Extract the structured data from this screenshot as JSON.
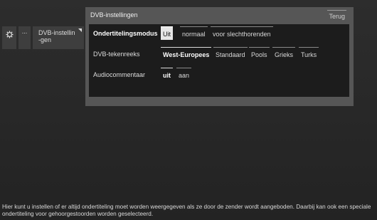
{
  "breadcrumb": {
    "gear_icon": "gear-icon",
    "more_label": "...",
    "current_label": "DVB-instellin-gen"
  },
  "dialog": {
    "title": "DVB-instellingen",
    "back_label": "Terug",
    "rows": [
      {
        "label": "Ondertitelingsmodus",
        "options": [
          "Uit",
          "normaal",
          "voor slechthorenden"
        ],
        "selected": "Uit"
      },
      {
        "label": "DVB-tekenreeks",
        "options": [
          "West-Europees",
          "Standaard",
          "Pools",
          "Grieks",
          "Turks"
        ],
        "selected": "West-Europees"
      },
      {
        "label": "Audiocommentaar",
        "options": [
          "uit",
          "aan"
        ],
        "selected": "uit"
      }
    ]
  },
  "description": "Hier kunt u instellen of er altijd ondertiteling moet worden weergegeven als ze door de zender wordt aangeboden. Daarbij kan ook een speciale ondertiteling voor gehoorgestoorden worden geselecteerd."
}
